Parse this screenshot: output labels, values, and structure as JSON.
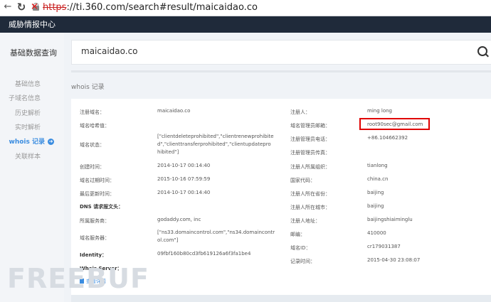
{
  "browser": {
    "url_scheme": "https",
    "url_rest": "://ti.360.com/search#result/maicaidao.co"
  },
  "topnav": {
    "tab": "威胁情报中心"
  },
  "sidebar": {
    "title": "基础数据查询",
    "items": [
      {
        "label": "基础信息"
      },
      {
        "label": "子域名信息"
      },
      {
        "label": "历史解析"
      },
      {
        "label": "实时解析"
      },
      {
        "label": "whois 记录"
      },
      {
        "label": "关联样本"
      }
    ]
  },
  "search": {
    "query": "maicaidao.co"
  },
  "section": {
    "title": "whois 记录"
  },
  "whois_left": [
    {
      "label": "注册域名：",
      "value": "maicaidao.co"
    },
    {
      "label": "域名哈希值：",
      "value": ""
    },
    {
      "label": "域名状态：",
      "value_lines": [
        "[\"clientdeleteprohibited\",\"clientrenewprohibite",
        "d\",\"clienttransferprohibited\",\"clientupdatepro",
        "hibited\"]"
      ]
    },
    {
      "label": "创建时间：",
      "value": "2014-10-17 00:14:40"
    },
    {
      "label": "域名过期时间：",
      "value": "2015-10-16 07:59:59"
    },
    {
      "label": "最后更新时间：",
      "value": "2014-10-17 00:14:40"
    },
    {
      "label": "DNS 请求报文头：",
      "value": ""
    },
    {
      "label": "所属服务商：",
      "value": "godaddy.com, inc"
    },
    {
      "label": "域名服务器：",
      "value_lines": [
        "[\"ns33.domaincontrol.com\",\"ns34.domaincontr",
        "ol.com\"]"
      ]
    },
    {
      "label": "Identity：",
      "value": "09fbf160b80cd3fb619126a6f3fa1be4"
    },
    {
      "label": "Whois Server：",
      "value": ""
    }
  ],
  "whois_right": [
    {
      "label": "注册人：",
      "value": "ming long"
    },
    {
      "label": "域名管理员邮箱：",
      "value": "root90sec@gmail.com"
    },
    {
      "label": "注册管理员电话：",
      "value": "+86.104662392"
    },
    {
      "label": "注册管理员传真：",
      "value": ""
    },
    {
      "label": "注册人所属组织：",
      "value": "tianlong"
    },
    {
      "label": "国家代码：",
      "value": "china.cn"
    },
    {
      "label": "注册人所在省份：",
      "value": "baijing"
    },
    {
      "label": "注册人所在城市：",
      "value": "baijing"
    },
    {
      "label": "注册人地址：",
      "value": "baijingshiaiminglu"
    },
    {
      "label": "邮编：",
      "value": "410000"
    },
    {
      "label": "域名ID：",
      "value": "cr179031387"
    },
    {
      "label": "记录时间：",
      "value": "2015-04-30 23:08:07"
    }
  ],
  "more_link": "查看详情",
  "watermark": "FREEBUF",
  "colors": {
    "accent": "#3b8de0",
    "highlight": "#e00000",
    "topnav": "#1f2a3a"
  }
}
